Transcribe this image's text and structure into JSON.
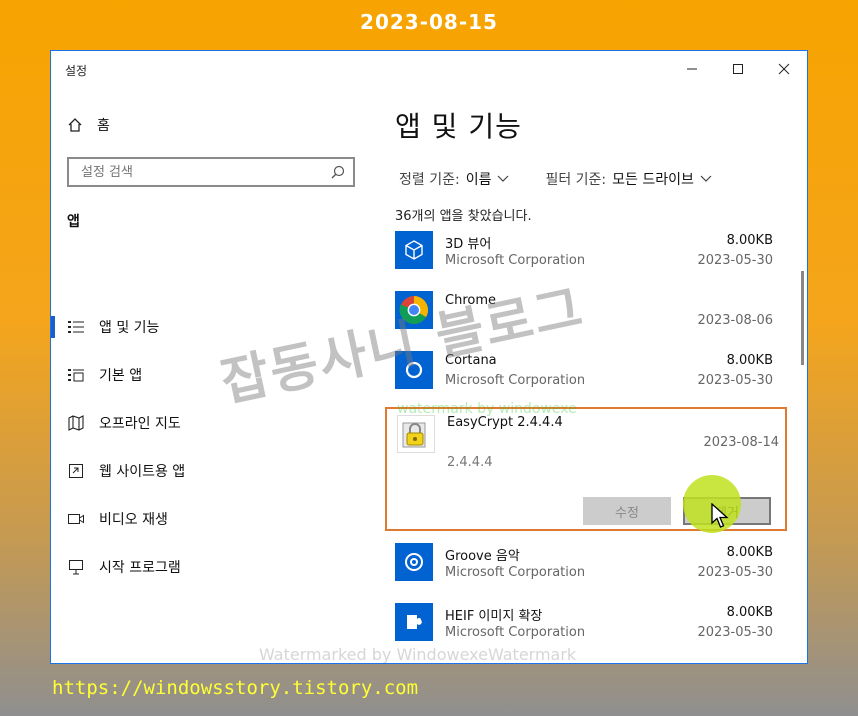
{
  "banner": {
    "date": "2023-08-15"
  },
  "footer": {
    "url": "https://windowsstory.tistory.com"
  },
  "window": {
    "title": "설정",
    "controls": {
      "minimize": "minimize-icon",
      "maximize": "maximize-icon",
      "close": "close-icon"
    }
  },
  "sidebar": {
    "home_label": "홈",
    "search_placeholder": "설정 검색",
    "section": "앱",
    "items": [
      {
        "label": "앱 및 기능",
        "icon": "apps-list-icon",
        "active": true
      },
      {
        "label": "기본 앱",
        "icon": "default-apps-icon",
        "active": false
      },
      {
        "label": "오프라인 지도",
        "icon": "offline-map-icon",
        "active": false
      },
      {
        "label": "웹 사이트용 앱",
        "icon": "web-app-icon",
        "active": false
      },
      {
        "label": "비디오 재생",
        "icon": "video-icon",
        "active": false
      },
      {
        "label": "시작 프로그램",
        "icon": "startup-icon",
        "active": false
      }
    ]
  },
  "main": {
    "title": "앱 및 기능",
    "sort_label": "정렬 기준:",
    "sort_value": "이름",
    "filter_label": "필터 기준:",
    "filter_value": "모든 드라이브",
    "count_text": "36개의 앱을 찾았습니다.",
    "apps": [
      {
        "name": "3D 뷰어",
        "publisher": "Microsoft Corporation",
        "size": "8.00KB",
        "date": "2023-05-30",
        "icon": "3d-viewer-icon",
        "color": "#0063d1"
      },
      {
        "name": "Chrome",
        "publisher": "",
        "size": "",
        "date": "2023-08-06",
        "icon": "chrome-icon",
        "color": "#0063d1"
      },
      {
        "name": "Cortana",
        "publisher": "Microsoft Corporation",
        "size": "8.00KB",
        "date": "2023-05-30",
        "icon": "cortana-icon",
        "color": "#0063d1"
      }
    ],
    "expanded_app": {
      "name": "EasyCrypt 2.4.4.4",
      "date": "2023-08-14",
      "version": "2.4.4.4",
      "modify_label": "수정",
      "uninstall_label": "제거"
    },
    "apps_after": [
      {
        "name": "Groove 음악",
        "publisher": "Microsoft Corporation",
        "size": "8.00KB",
        "date": "2023-05-30",
        "icon": "groove-music-icon",
        "color": "#0063d1"
      },
      {
        "name": "HEIF 이미지 확장",
        "publisher": "Microsoft Corporation",
        "size": "8.00KB",
        "date": "2023-05-30",
        "icon": "heif-extension-icon",
        "color": "#0063d1"
      }
    ]
  },
  "watermarks": {
    "big": "잡동사니 블로그",
    "small": "watermark by windowexe",
    "bottom": "Watermarked by WindowexeWatermark"
  }
}
